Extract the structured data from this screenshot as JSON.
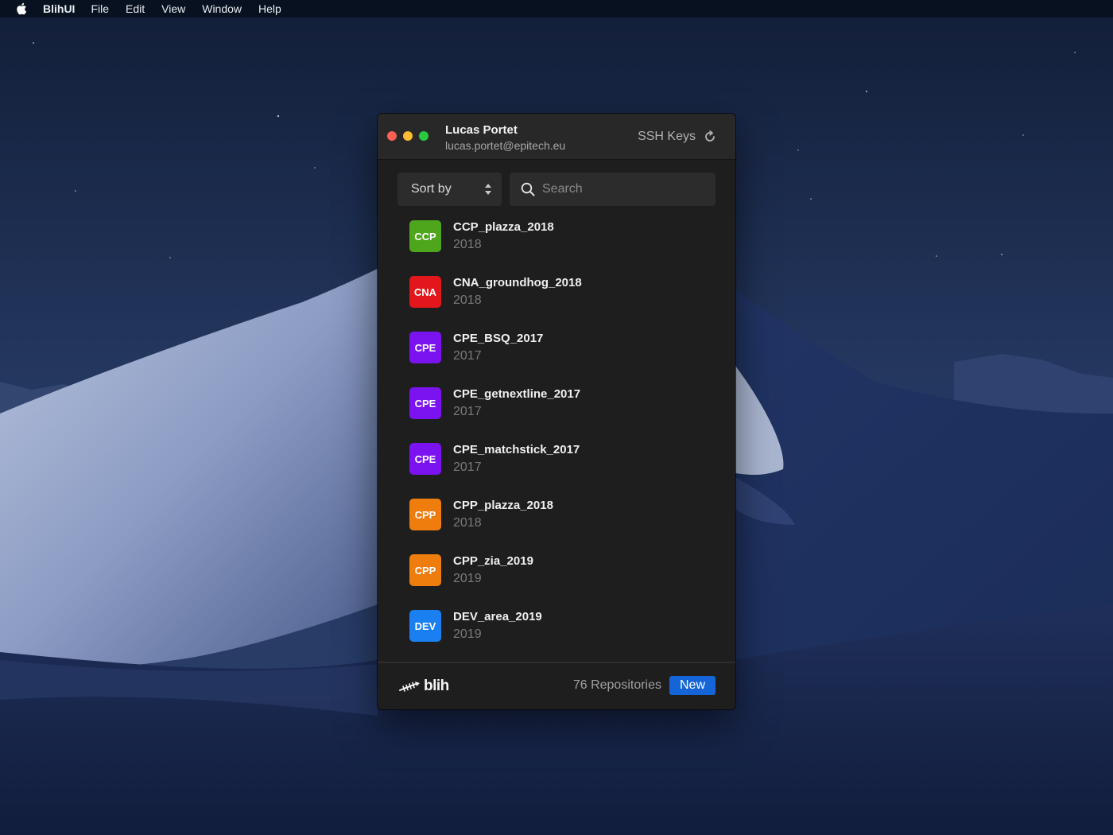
{
  "menubar": {
    "app_name": "BlihUI",
    "items": [
      "File",
      "Edit",
      "View",
      "Window",
      "Help"
    ]
  },
  "window": {
    "user_name": "Lucas Portet",
    "user_email": "lucas.portet@epitech.eu",
    "ssh_keys_label": "SSH Keys"
  },
  "toolbar": {
    "sort_label": "Sort by",
    "search_placeholder": "Search",
    "search_value": ""
  },
  "repos": [
    {
      "tag": "CCP",
      "name": "CCP_plazza_2018",
      "year": "2018",
      "color": "#4da61b"
    },
    {
      "tag": "CNA",
      "name": "CNA_groundhog_2018",
      "year": "2018",
      "color": "#e3161b"
    },
    {
      "tag": "CPE",
      "name": "CPE_BSQ_2017",
      "year": "2017",
      "color": "#7b12f0"
    },
    {
      "tag": "CPE",
      "name": "CPE_getnextline_2017",
      "year": "2017",
      "color": "#7b12f0"
    },
    {
      "tag": "CPE",
      "name": "CPE_matchstick_2017",
      "year": "2017",
      "color": "#7b12f0"
    },
    {
      "tag": "CPP",
      "name": "CPP_plazza_2018",
      "year": "2018",
      "color": "#ef7d0e"
    },
    {
      "tag": "CPP",
      "name": "CPP_zia_2019",
      "year": "2019",
      "color": "#ef7d0e"
    },
    {
      "tag": "DEV",
      "name": "DEV_area_2019",
      "year": "2019",
      "color": "#1a7ff0"
    }
  ],
  "footer": {
    "logo_text": "blih",
    "repo_count": "76 Repositories",
    "new_label": "New"
  },
  "colors": {
    "accent": "#1565d8",
    "window_bg": "#1e1e1e",
    "titlebar_bg": "#282828"
  }
}
